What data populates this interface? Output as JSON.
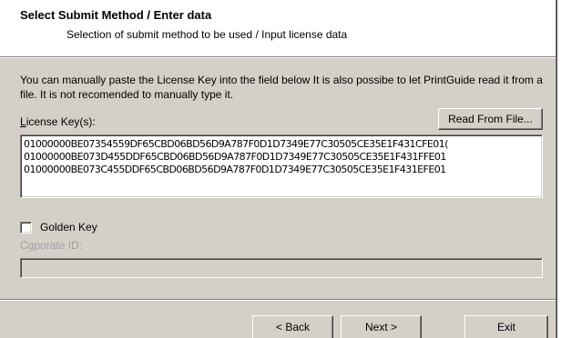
{
  "header": {
    "title": "Select Submit Method / Enter data",
    "subtitle": "Selection of submit method to be used / Input license data"
  },
  "description": "You can manually paste the License Key into the field below It is also possibe to let PrintGuide read it from a file. It is not recomended to manually type it.",
  "license": {
    "label_prefix": "L",
    "label_rest": "icense Key(s):",
    "read_button_label": "Read From File...",
    "lines": [
      "01000000BE07354559DF65CBD06BD56D9A787F0D1D7349E77C30505CE35E1F431CFE01(",
      "01000000BE073D455DDF65CBD06BD56D9A787F0D1D7349E77C30505CE35E1F431FFE01",
      "01000000BE073C455DDF65CBD06BD56D9A787F0D1D7349E77C30505CE35E1F431EFE01"
    ]
  },
  "golden_key": {
    "label": "Golden Key",
    "checked": false
  },
  "corporate": {
    "label": "Cgporate ID:",
    "value": ""
  },
  "footer": {
    "back_label": "< Back",
    "next_label": "Next >",
    "exit_label": "Exit"
  }
}
